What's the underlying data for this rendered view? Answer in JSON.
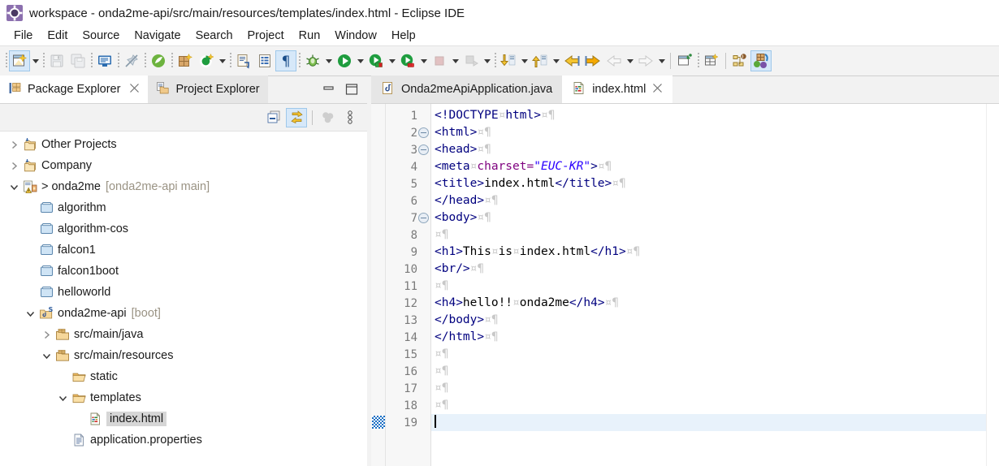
{
  "window": {
    "title": "workspace - onda2me-api/src/main/resources/templates/index.html - Eclipse IDE",
    "app_icon": "eclipse-icon"
  },
  "menubar": {
    "items": [
      {
        "label": "File"
      },
      {
        "label": "Edit"
      },
      {
        "label": "Source"
      },
      {
        "label": "Navigate"
      },
      {
        "label": "Search"
      },
      {
        "label": "Project"
      },
      {
        "label": "Run"
      },
      {
        "label": "Window"
      },
      {
        "label": "Help"
      }
    ]
  },
  "toolbar": {
    "items": [
      {
        "name": "new-wizard-button",
        "icon": "new-file-icon",
        "active": true,
        "dropdown": true
      },
      {
        "name": "save-button",
        "icon": "save-icon",
        "disabled": true
      },
      {
        "name": "save-all-button",
        "icon": "save-all-icon",
        "disabled": true
      },
      {
        "name": "open-console-button",
        "icon": "console-icon"
      },
      {
        "name": "toggle-link-button",
        "icon": "pin-off-icon",
        "disabled": true
      },
      {
        "name": "spring-boot-dashboard-button",
        "icon": "spring-leaf-icon"
      },
      {
        "name": "new-java-package-button",
        "icon": "new-package-icon"
      },
      {
        "name": "external-tools-button",
        "icon": "external-tools-icon",
        "dropdown": true
      },
      {
        "name": "open-task-button",
        "icon": "task-icon"
      },
      {
        "name": "open-type-button",
        "icon": "open-type-icon"
      },
      {
        "name": "show-whitespace-button",
        "icon": "pilcrow-icon",
        "active": true
      },
      {
        "name": "debug-button",
        "icon": "bug-icon",
        "dropdown": true
      },
      {
        "name": "run-button",
        "icon": "run-green-icon",
        "dropdown": true
      },
      {
        "name": "run-as-server-button",
        "icon": "run-server-icon",
        "dropdown": true
      },
      {
        "name": "coverage-button",
        "icon": "coverage-icon",
        "dropdown": true
      },
      {
        "name": "stop-button",
        "icon": "stop-icon",
        "disabled": true,
        "dropdown": true
      },
      {
        "name": "relaunch-button",
        "icon": "relaunch-icon",
        "disabled": true,
        "dropdown": true
      },
      {
        "name": "step-into-button",
        "icon": "step-into-icon",
        "dropdown": true
      },
      {
        "name": "step-return-button",
        "icon": "step-return-icon",
        "dropdown": true
      },
      {
        "name": "back-button",
        "icon": "back-arrow-icon"
      },
      {
        "name": "forward-button",
        "icon": "forward-arrow-icon"
      },
      {
        "name": "previous-annotation-button",
        "icon": "prev-annotation-icon",
        "disabled": true,
        "dropdown": true
      },
      {
        "name": "next-annotation-button",
        "icon": "next-annotation-icon",
        "disabled": true,
        "dropdown": true
      },
      {
        "name": "new-window-button",
        "icon": "new-window-icon"
      },
      {
        "name": "new-editor-button",
        "icon": "new-editor-icon"
      },
      {
        "name": "perspective-java-button",
        "icon": "java-perspective-icon"
      },
      {
        "name": "perspective-spring-button",
        "icon": "spring-perspective-icon",
        "active": true
      }
    ]
  },
  "left_view": {
    "tabs": [
      {
        "label": "Package Explorer",
        "icon": "package-explorer-icon",
        "selected": true,
        "closable": true
      },
      {
        "label": "Project Explorer",
        "icon": "project-explorer-icon",
        "selected": false,
        "closable": false
      }
    ],
    "view_controls": [
      {
        "name": "minimize-view-button",
        "icon": "minimize-icon"
      },
      {
        "name": "maximize-view-button",
        "icon": "maximize-icon"
      }
    ],
    "toolbar": [
      {
        "name": "collapse-all-button",
        "icon": "collapse-all-icon"
      },
      {
        "name": "link-with-editor-button",
        "icon": "link-with-editor-icon",
        "active": true
      },
      {
        "name": "focus-on-active-task-button",
        "icon": "focus-task-icon",
        "disabled": true
      },
      {
        "name": "view-menu-button",
        "icon": "view-menu-icon"
      }
    ],
    "tree": [
      {
        "indent": 0,
        "twist": "collapsed",
        "icon": "project-group-icon",
        "label": "Other Projects",
        "sub": "",
        "selected": false
      },
      {
        "indent": 0,
        "twist": "collapsed",
        "icon": "project-group-icon",
        "label": "Company",
        "sub": "",
        "selected": false
      },
      {
        "indent": 0,
        "twist": "expanded",
        "icon": "project-warning-icon",
        "label": "> onda2me",
        "sub": "[onda2me-api main]",
        "selected": false
      },
      {
        "indent": 1,
        "twist": "none",
        "icon": "closed-project-icon",
        "label": "algorithm",
        "sub": "",
        "selected": false
      },
      {
        "indent": 1,
        "twist": "none",
        "icon": "closed-project-icon",
        "label": "algorithm-cos",
        "sub": "",
        "selected": false
      },
      {
        "indent": 1,
        "twist": "none",
        "icon": "closed-project-icon",
        "label": "falcon1",
        "sub": "",
        "selected": false
      },
      {
        "indent": 1,
        "twist": "none",
        "icon": "closed-project-icon",
        "label": "falcon1boot",
        "sub": "",
        "selected": false
      },
      {
        "indent": 1,
        "twist": "none",
        "icon": "closed-project-icon",
        "label": "helloworld",
        "sub": "",
        "selected": false
      },
      {
        "indent": 1,
        "twist": "expanded",
        "icon": "java-project-icon",
        "label": "onda2me-api",
        "sub": "[boot]",
        "selected": false
      },
      {
        "indent": 2,
        "twist": "collapsed",
        "icon": "source-folder-icon",
        "label": "src/main/java",
        "sub": "",
        "selected": false
      },
      {
        "indent": 2,
        "twist": "expanded",
        "icon": "source-folder-icon",
        "label": "src/main/resources",
        "sub": "",
        "selected": false
      },
      {
        "indent": 3,
        "twist": "none",
        "icon": "folder-icon",
        "label": "static",
        "sub": "",
        "selected": false
      },
      {
        "indent": 3,
        "twist": "expanded",
        "icon": "folder-icon",
        "label": "templates",
        "sub": "",
        "selected": false
      },
      {
        "indent": 4,
        "twist": "none",
        "icon": "html-file-icon",
        "label": "index.html",
        "sub": "",
        "selected": true
      },
      {
        "indent": 3,
        "twist": "none",
        "icon": "properties-file-icon",
        "label": "application.properties",
        "sub": "",
        "selected": false
      }
    ]
  },
  "editor": {
    "tabs": [
      {
        "label": "Onda2meApiApplication.java",
        "icon": "java-file-icon",
        "selected": false,
        "closable": false
      },
      {
        "label": "index.html",
        "icon": "html-file-icon",
        "selected": true,
        "closable": true
      }
    ],
    "cursor_line": 19,
    "lines": [
      {
        "n": "1",
        "fold": false,
        "segments": [
          {
            "t": "tag",
            "v": "<!DOCTYPE"
          },
          {
            "t": "ws",
            "v": "¤"
          },
          {
            "t": "tag",
            "v": "html>"
          },
          {
            "t": "ws",
            "v": "¤¶"
          }
        ]
      },
      {
        "n": "2",
        "fold": true,
        "segments": [
          {
            "t": "tag",
            "v": "<html>"
          },
          {
            "t": "ws",
            "v": "¤¶"
          }
        ]
      },
      {
        "n": "3",
        "fold": true,
        "segments": [
          {
            "t": "tag",
            "v": "<head>"
          },
          {
            "t": "ws",
            "v": "¤¶"
          }
        ]
      },
      {
        "n": "4",
        "fold": false,
        "segments": [
          {
            "t": "tag",
            "v": "<meta"
          },
          {
            "t": "ws",
            "v": "¤"
          },
          {
            "t": "attr",
            "v": "charset="
          },
          {
            "t": "str",
            "v": "\"EUC-KR\""
          },
          {
            "t": "tag",
            "v": ">"
          },
          {
            "t": "ws",
            "v": "¤¶"
          }
        ]
      },
      {
        "n": "5",
        "fold": false,
        "segments": [
          {
            "t": "tag",
            "v": "<title>"
          },
          {
            "t": "txt",
            "v": "index.html"
          },
          {
            "t": "tag",
            "v": "</title>"
          },
          {
            "t": "ws",
            "v": "¤¶"
          }
        ]
      },
      {
        "n": "6",
        "fold": false,
        "segments": [
          {
            "t": "tag",
            "v": "</head>"
          },
          {
            "t": "ws",
            "v": "¤¶"
          }
        ]
      },
      {
        "n": "7",
        "fold": true,
        "segments": [
          {
            "t": "tag",
            "v": "<body>"
          },
          {
            "t": "ws",
            "v": "¤¶"
          }
        ]
      },
      {
        "n": "8",
        "fold": false,
        "segments": [
          {
            "t": "ws",
            "v": "¤¶"
          }
        ]
      },
      {
        "n": "9",
        "fold": false,
        "segments": [
          {
            "t": "tag",
            "v": "<h1>"
          },
          {
            "t": "txt",
            "v": "This"
          },
          {
            "t": "ws",
            "v": "¤"
          },
          {
            "t": "txt",
            "v": "is"
          },
          {
            "t": "ws",
            "v": "¤"
          },
          {
            "t": "txt",
            "v": "index.html"
          },
          {
            "t": "tag",
            "v": "</h1>"
          },
          {
            "t": "ws",
            "v": "¤¶"
          }
        ]
      },
      {
        "n": "10",
        "fold": false,
        "segments": [
          {
            "t": "tag",
            "v": "<br/>"
          },
          {
            "t": "ws",
            "v": "¤¶"
          }
        ]
      },
      {
        "n": "11",
        "fold": false,
        "segments": [
          {
            "t": "ws",
            "v": "¤¶"
          }
        ]
      },
      {
        "n": "12",
        "fold": false,
        "segments": [
          {
            "t": "tag",
            "v": "<h4>"
          },
          {
            "t": "txt",
            "v": "hello!!"
          },
          {
            "t": "ws",
            "v": "¤"
          },
          {
            "t": "txt",
            "v": "onda2me"
          },
          {
            "t": "tag",
            "v": "</h4>"
          },
          {
            "t": "ws",
            "v": "¤¶"
          }
        ]
      },
      {
        "n": "13",
        "fold": false,
        "segments": [
          {
            "t": "tag",
            "v": "</body>"
          },
          {
            "t": "ws",
            "v": "¤¶"
          }
        ]
      },
      {
        "n": "14",
        "fold": false,
        "segments": [
          {
            "t": "tag",
            "v": "</html>"
          },
          {
            "t": "ws",
            "v": "¤¶"
          }
        ]
      },
      {
        "n": "15",
        "fold": false,
        "segments": [
          {
            "t": "ws",
            "v": "¤¶"
          }
        ]
      },
      {
        "n": "16",
        "fold": false,
        "segments": [
          {
            "t": "ws",
            "v": "¤¶"
          }
        ]
      },
      {
        "n": "17",
        "fold": false,
        "segments": [
          {
            "t": "ws",
            "v": "¤¶"
          }
        ]
      },
      {
        "n": "18",
        "fold": false,
        "segments": [
          {
            "t": "ws",
            "v": "¤¶"
          }
        ]
      },
      {
        "n": "19",
        "fold": false,
        "current": true,
        "caret": true,
        "segments": []
      }
    ]
  },
  "colors": {
    "tag": "#00007f",
    "attribute": "#7f007f",
    "string": "#2a00ff",
    "text": "#000000",
    "whitespace_marker": "#c8c8c8",
    "current_line": "#e8f2fb",
    "selection": "#d6d6d6",
    "toolbar_bg": "#f3f3f3",
    "tab_inactive": "#e6e6e6",
    "gutter_bg": "#f7f7f7"
  }
}
